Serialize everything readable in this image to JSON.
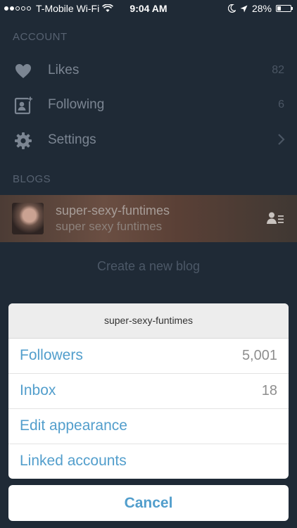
{
  "status_bar": {
    "carrier": "T-Mobile Wi-Fi",
    "time": "9:04 AM",
    "battery": "28%",
    "signal_bars": 2,
    "battery_level": 0.28
  },
  "account": {
    "header": "ACCOUNT",
    "items": [
      {
        "label": "Likes",
        "count": "82",
        "icon": "heart-icon"
      },
      {
        "label": "Following",
        "count": "6",
        "icon": "following-icon"
      },
      {
        "label": "Settings",
        "icon": "gear-icon"
      }
    ]
  },
  "blogs": {
    "header": "BLOGS",
    "blog": {
      "name": "super-sexy-funtimes",
      "title": "super sexy funtimes"
    },
    "create_label": "Create a new blog"
  },
  "action_sheet": {
    "title": "super-sexy-funtimes",
    "items": [
      {
        "label": "Followers",
        "value": "5,001"
      },
      {
        "label": "Inbox",
        "value": "18"
      },
      {
        "label": "Edit appearance"
      },
      {
        "label": "Linked accounts"
      }
    ],
    "cancel_label": "Cancel"
  },
  "colors": {
    "accent": "#529ecc",
    "background": "#1f2a36"
  }
}
